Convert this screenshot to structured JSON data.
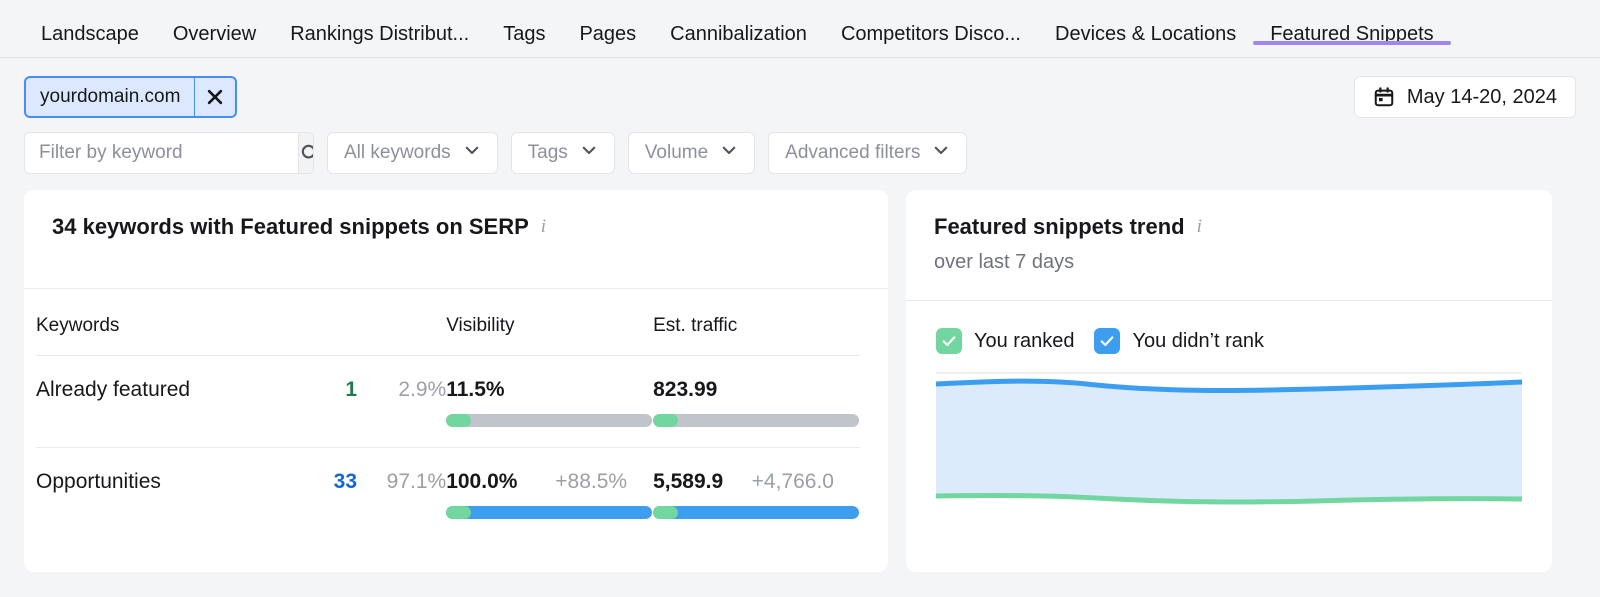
{
  "nav": {
    "items": [
      {
        "label": "Landscape",
        "active": false
      },
      {
        "label": "Overview",
        "active": false
      },
      {
        "label": "Rankings Distribut...",
        "active": false
      },
      {
        "label": "Tags",
        "active": false
      },
      {
        "label": "Pages",
        "active": false
      },
      {
        "label": "Cannibalization",
        "active": false
      },
      {
        "label": "Competitors Disco...",
        "active": false
      },
      {
        "label": "Devices & Locations",
        "active": false
      },
      {
        "label": "Featured Snippets",
        "active": true
      }
    ],
    "active_underline_color": "#a285f0"
  },
  "filters": {
    "domain_chip": {
      "label": "yourdomain.com",
      "close_icon": "close-icon"
    },
    "search": {
      "value": "",
      "placeholder": "Filter by keyword",
      "icon": "search-icon"
    },
    "dropdowns": [
      {
        "label": "All keywords"
      },
      {
        "label": "Tags"
      },
      {
        "label": "Volume"
      },
      {
        "label": "Advanced filters"
      }
    ],
    "date_range": {
      "label": "May 14-20, 2024",
      "icon": "calendar-icon"
    }
  },
  "left_card": {
    "title": "34 keywords with Featured snippets on SERP",
    "info_icon": "info-icon",
    "table": {
      "headers": [
        "Keywords",
        "",
        "",
        "Visibility",
        "Est. traffic"
      ],
      "rows": [
        {
          "name": "Already featured",
          "count": "1",
          "count_color": "green",
          "share": "2.9%",
          "visibility": {
            "value": "11.5%",
            "delta": "",
            "green_pct": 12,
            "rest_pct": 100,
            "rest_color": "#c1c4cb"
          },
          "traffic": {
            "value": "823.99",
            "delta": "",
            "green_pct": 12,
            "rest_pct": 100,
            "rest_color": "#c1c4cb"
          }
        },
        {
          "name": "Opportunities",
          "count": "33",
          "count_color": "blue",
          "share": "97.1%",
          "visibility": {
            "value": "100.0%",
            "delta": "+88.5%",
            "green_pct": 12,
            "rest_pct": 100,
            "rest_color": "#3d9ef0"
          },
          "traffic": {
            "value": "5,589.9",
            "delta": "+4,766.0",
            "green_pct": 12,
            "rest_pct": 100,
            "rest_color": "#3d9ef0"
          }
        }
      ]
    }
  },
  "right_card": {
    "title": "Featured snippets trend",
    "info_icon": "info-icon",
    "subtitle": "over last 7 days",
    "legend": [
      {
        "label": "You ranked",
        "color": "#72d6a0",
        "checked": true
      },
      {
        "label": "You didn’t rank",
        "color": "#3d9ef0",
        "checked": true
      }
    ]
  },
  "chart_data": {
    "type": "area",
    "title": "Featured snippets trend",
    "subtitle": "over last 7 days",
    "xlabel": "",
    "ylabel": "",
    "grid": true,
    "legend_position": "top-left",
    "x": [
      1,
      2,
      3,
      4,
      5,
      6,
      7
    ],
    "series": [
      {
        "name": "You didn’t rank",
        "color": "#3d9ef0",
        "values": [
          33,
          33,
          33,
          33,
          33,
          33,
          33
        ]
      },
      {
        "name": "You ranked",
        "color": "#72d6a0",
        "values": [
          1,
          1,
          1,
          1,
          1,
          1,
          1
        ]
      }
    ],
    "ylim": [
      0,
      34
    ],
    "gridline_count": 4,
    "fill_color": "#dbeafc"
  }
}
